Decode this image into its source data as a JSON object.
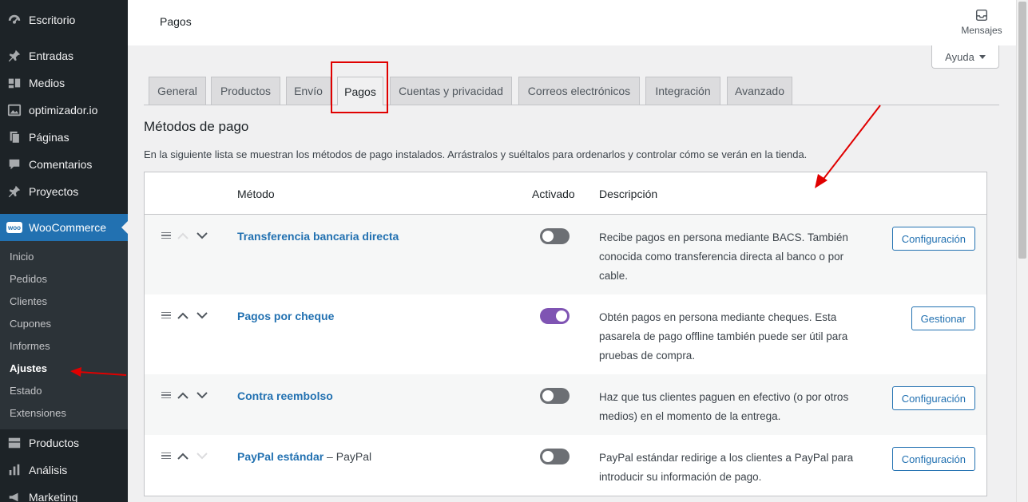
{
  "sidebar": {
    "top_items": [
      {
        "label": "Escritorio",
        "icon": "dashboard-icon"
      },
      {
        "label": "Entradas",
        "icon": "pin-icon"
      },
      {
        "label": "Medios",
        "icon": "media-icon"
      },
      {
        "label": "optimizador.io",
        "icon": "image-icon"
      },
      {
        "label": "Páginas",
        "icon": "page-icon"
      },
      {
        "label": "Comentarios",
        "icon": "comment-icon"
      },
      {
        "label": "Proyectos",
        "icon": "pin-icon"
      }
    ],
    "woocommerce": {
      "label": "WooCommerce",
      "badge": "woo"
    },
    "submenu": [
      "Inicio",
      "Pedidos",
      "Clientes",
      "Cupones",
      "Informes",
      "Ajustes",
      "Estado",
      "Extensiones"
    ],
    "bottom_items": [
      {
        "label": "Productos",
        "icon": "products-icon"
      },
      {
        "label": "Análisis",
        "icon": "chart-icon"
      },
      {
        "label": "Marketing",
        "icon": "megaphone-icon"
      }
    ]
  },
  "header": {
    "title": "Pagos",
    "inbox_label": "Mensajes"
  },
  "help": {
    "label": "Ayuda"
  },
  "tabs": [
    "General",
    "Productos",
    "Envío",
    "Pagos",
    "Cuentas y privacidad",
    "Correos electrónicos",
    "Integración",
    "Avanzado"
  ],
  "section": {
    "title": "Métodos de pago",
    "description": "En la siguiente lista se muestran los métodos de pago instalados. Arrástralos y suéltalos para ordenarlos y controlar cómo se verán en la tienda."
  },
  "table": {
    "headers": {
      "method": "Método",
      "enabled": "Activado",
      "description": "Descripción"
    },
    "rows": [
      {
        "name": "Transferencia bancaria directa",
        "suffix": "",
        "enabled": false,
        "description": "Recibe pagos en persona mediante BACS. También conocida como transferencia directa al banco o por cable.",
        "action": "Configuración"
      },
      {
        "name": "Pagos por cheque",
        "suffix": "",
        "enabled": true,
        "description": "Obtén pagos en persona mediante cheques. Esta pasarela de pago offline también puede ser útil para pruebas de compra.",
        "action": "Gestionar"
      },
      {
        "name": "Contra reembolso",
        "suffix": "",
        "enabled": false,
        "description": "Haz que tus clientes paguen en efectivo (o por otros medios) en el momento de la entrega.",
        "action": "Configuración"
      },
      {
        "name": "PayPal estándar",
        "suffix": " – PayPal",
        "enabled": false,
        "description": "PayPal estándar redirige a los clientes a PayPal para introducir su información de pago.",
        "action": "Configuración"
      }
    ]
  },
  "colors": {
    "accent": "#2271b1",
    "toggle_on": "#7f54b3",
    "annotation": "#e00000",
    "sidebar": "#1d2327"
  }
}
